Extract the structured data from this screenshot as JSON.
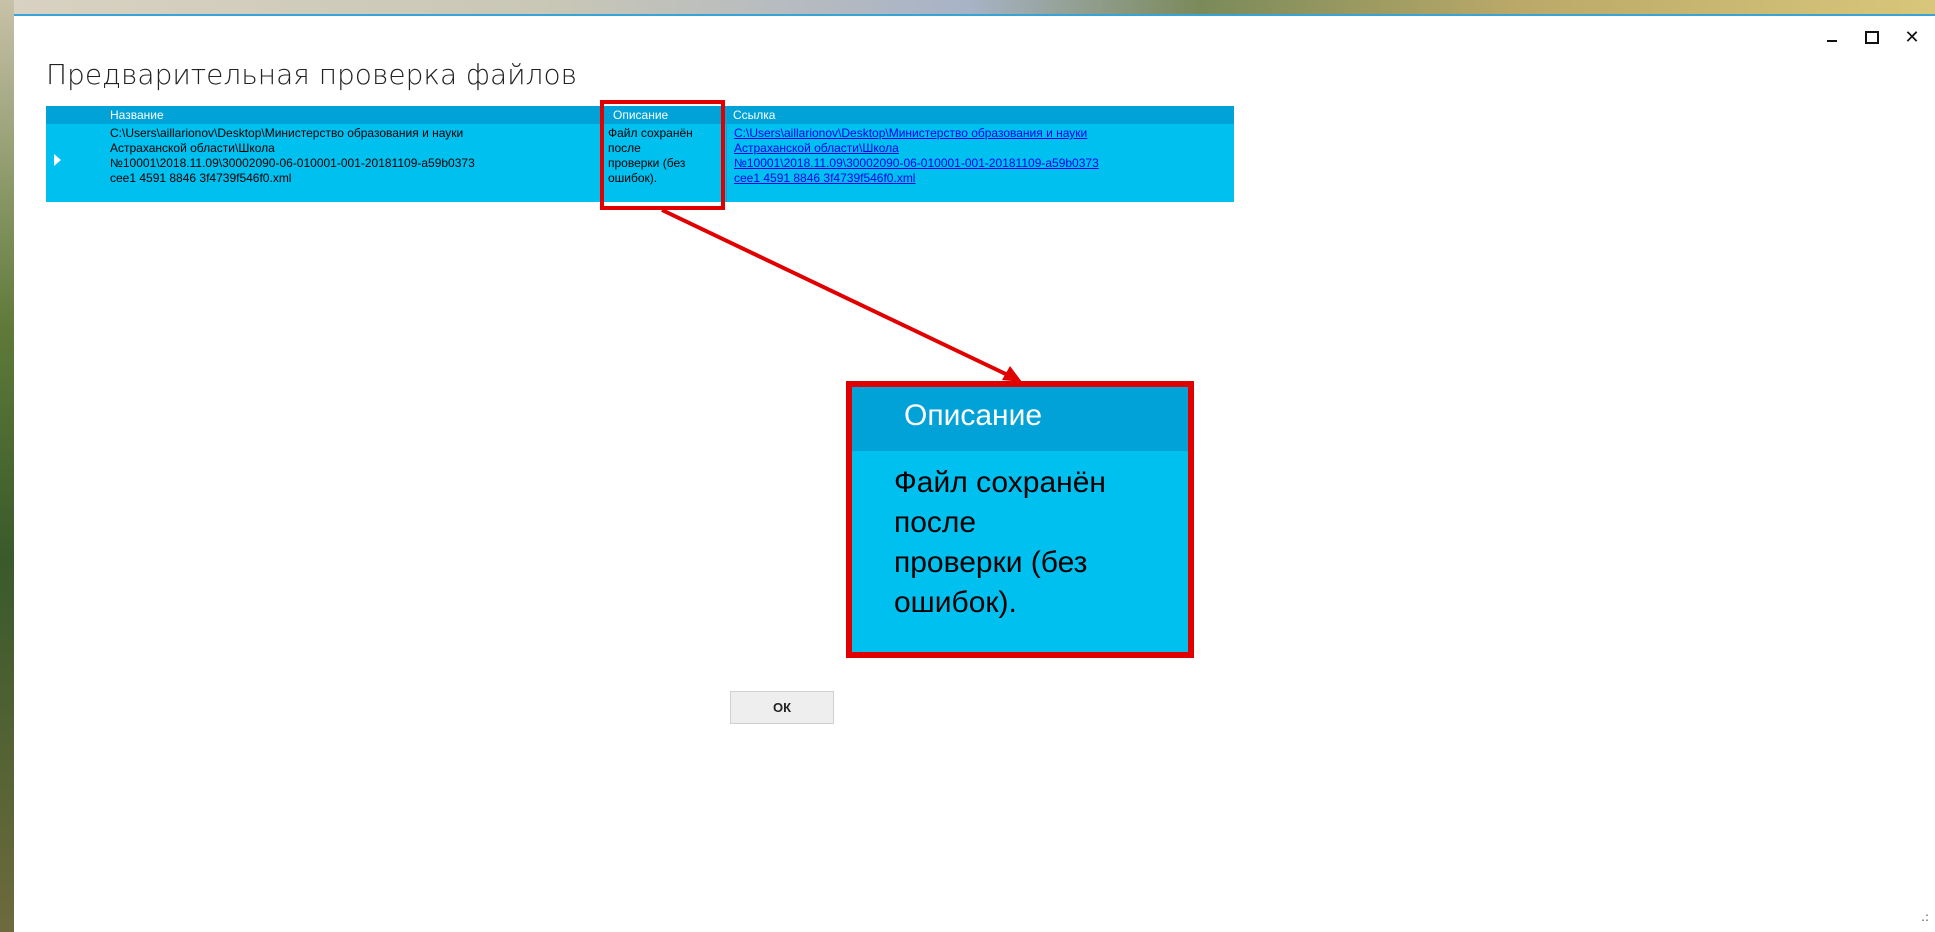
{
  "window": {
    "title": "Предварительная проверка файлов",
    "controls": {
      "minimize": "minimize",
      "maximize": "maximize",
      "close": "✕"
    }
  },
  "grid": {
    "columns": [
      "Название",
      "Описание",
      "Ссылка"
    ],
    "rows": [
      {
        "name": "C:\\Users\\aillarionov\\Desktop\\Министерство образования и науки\nАстраханской области\\Школа\n№10001\\2018.11.09\\30002090-06-010001-001-20181109-a59b0373\ncee1 4591 8846 3f4739f546f0.xml",
        "description": "Файл сохранён\nпосле\nпроверки (без\nошибок).",
        "link": "C:\\Users\\aillarionov\\Desktop\\Министерство образования и науки\nАстраханской области\\Школа\n№10001\\2018.11.09\\30002090-06-010001-001-20181109-a59b0373\ncee1 4591 8846 3f4739f546f0.xml"
      }
    ]
  },
  "zoom": {
    "header": "Описание",
    "body": "Файл сохранён\nпосле\nпроверки (без\nошибок)."
  },
  "buttons": {
    "ok": "ОК"
  },
  "colors": {
    "grid_bg": "#00c0f0",
    "grid_header": "#00a2d8",
    "highlight": "#e00000"
  }
}
